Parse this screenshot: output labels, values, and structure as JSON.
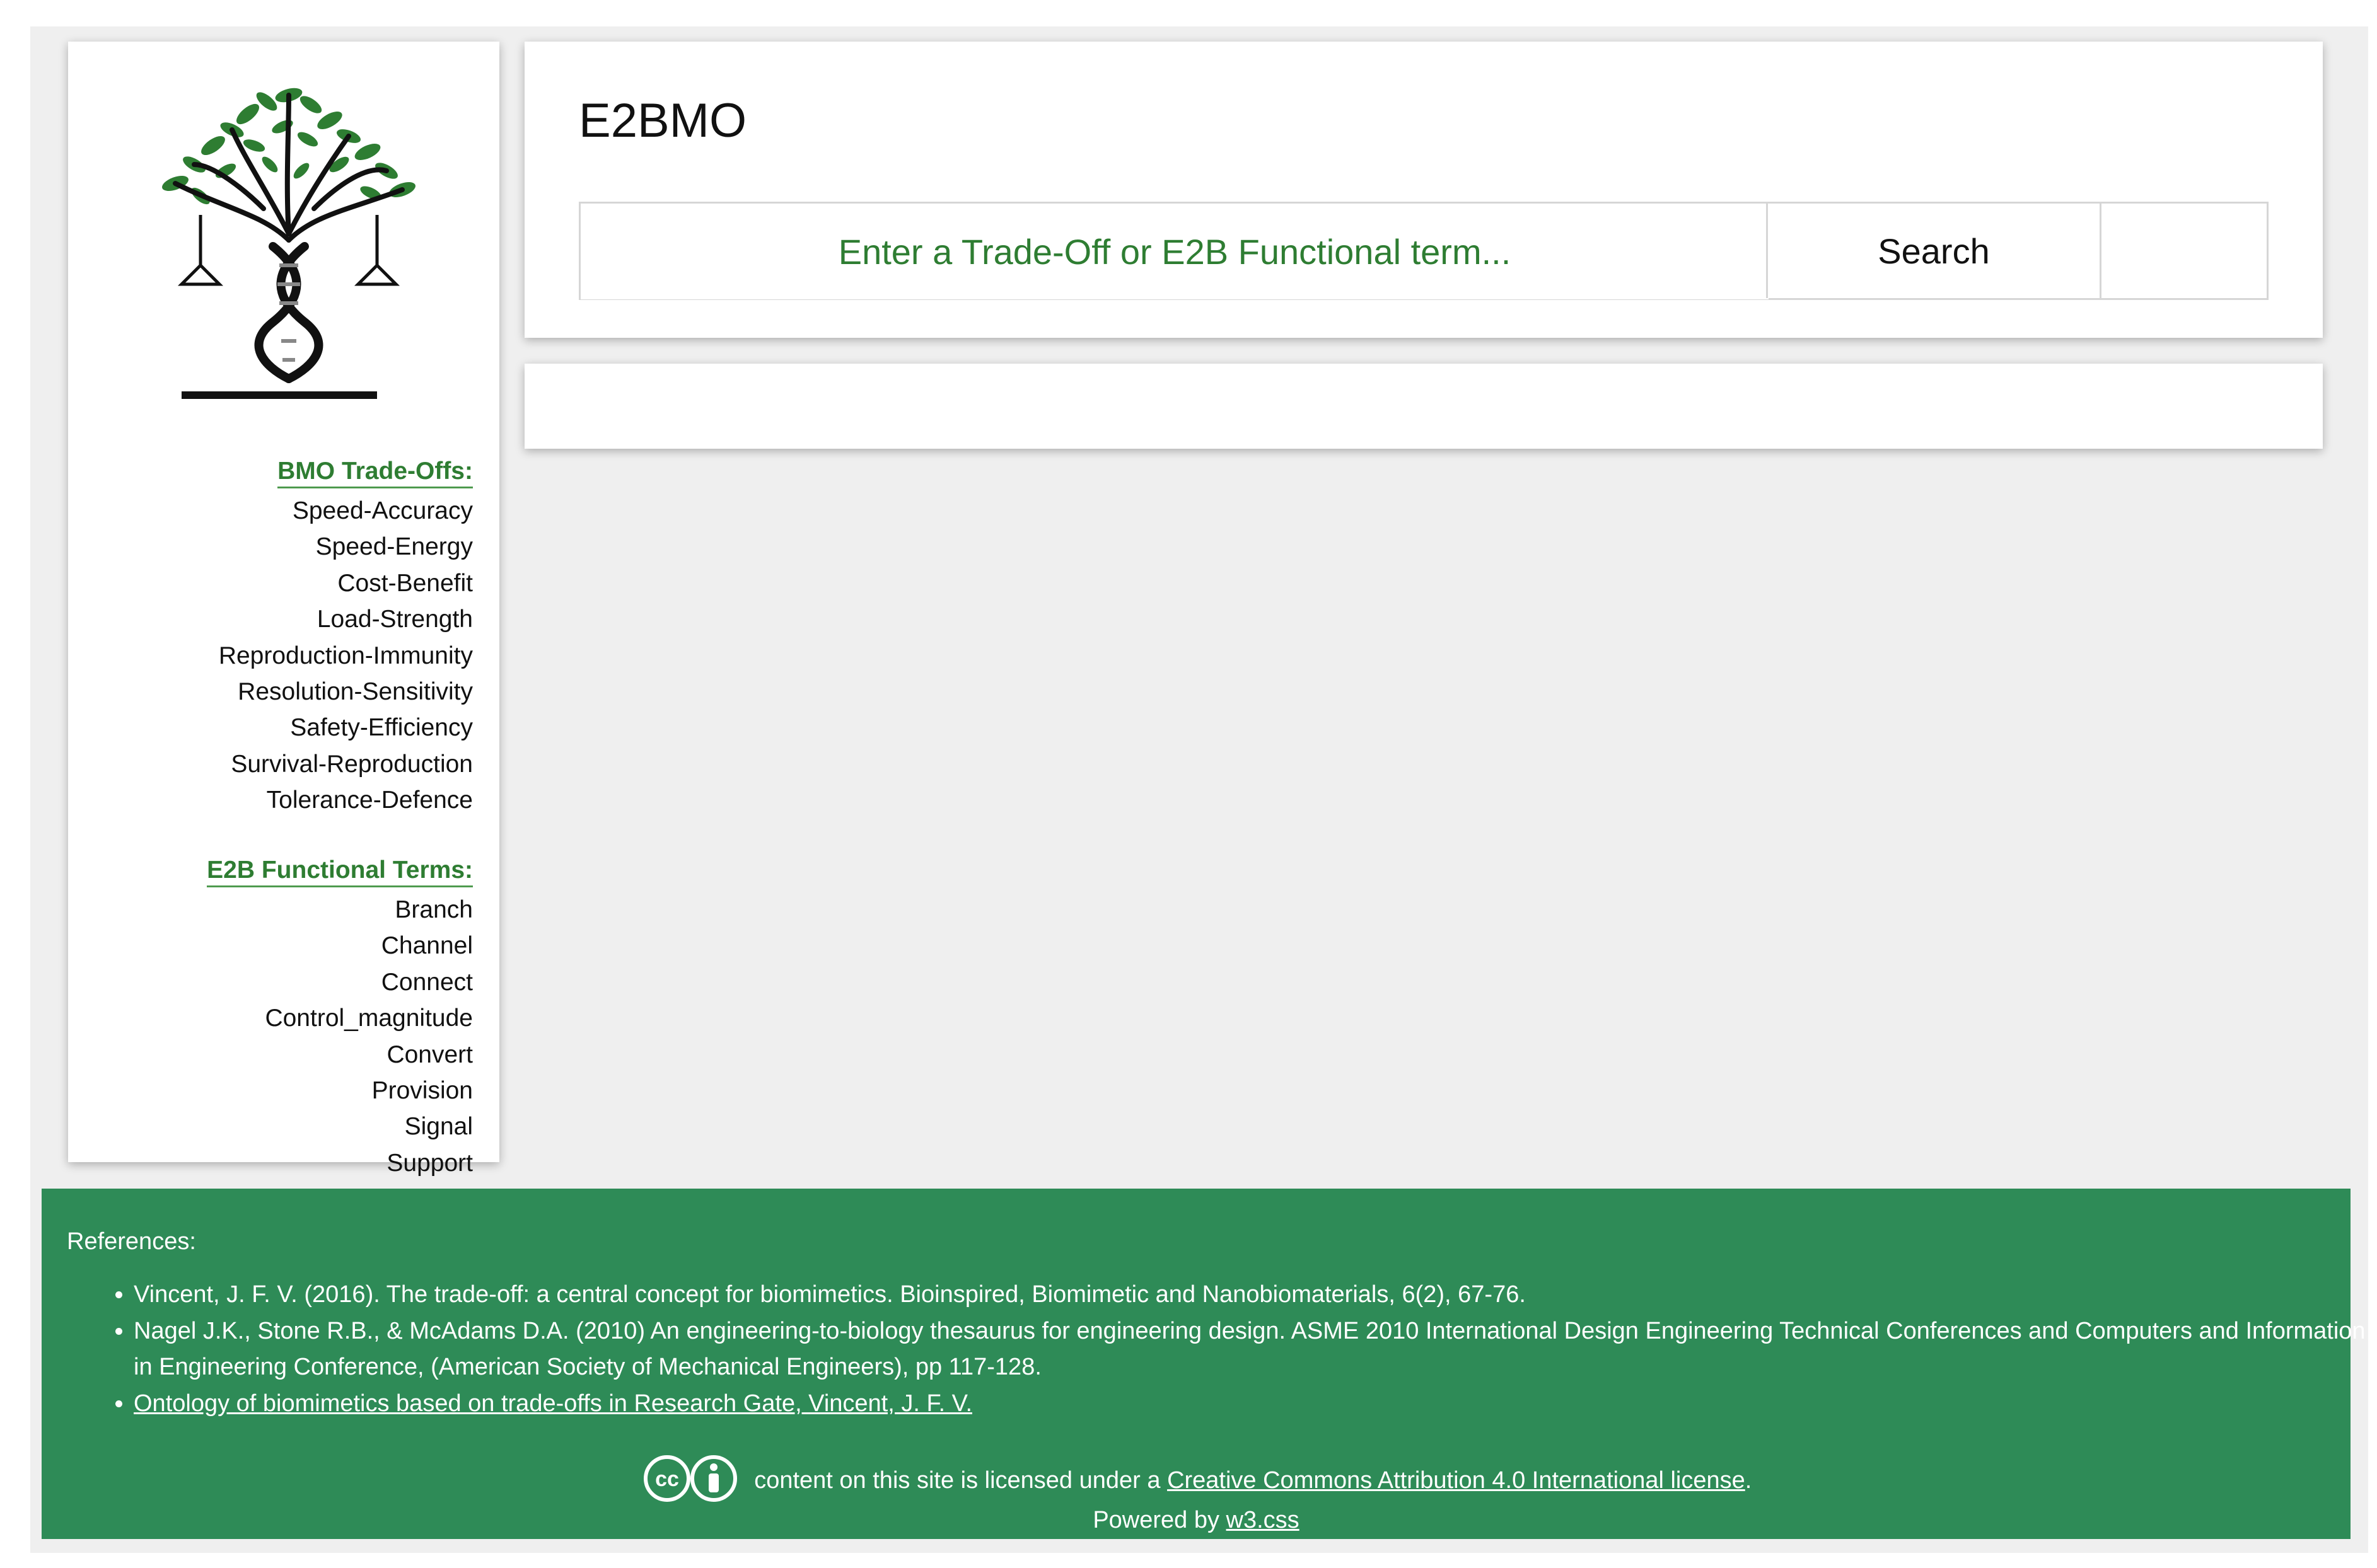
{
  "app": {
    "title": "E2BMO"
  },
  "search": {
    "placeholder": "Enter a Trade-Off or E2B Functional term...",
    "button_label": "Search"
  },
  "sidebar": {
    "tradeoffs_heading": "BMO Trade-Offs:",
    "tradeoffs": [
      "Speed-Accuracy",
      "Speed-Energy",
      "Cost-Benefit",
      "Load-Strength",
      "Reproduction-Immunity",
      "Resolution-Sensitivity",
      "Safety-Efficiency",
      "Survival-Reproduction",
      "Tolerance-Defence"
    ],
    "terms_heading": "E2B Functional Terms:",
    "terms": [
      "Branch",
      "Channel",
      "Connect",
      "Control_magnitude",
      "Convert",
      "Provision",
      "Signal",
      "Support"
    ]
  },
  "footer": {
    "references_label": "References:",
    "references": [
      "Vincent, J. F. V. (2016). The trade-off: a central concept for biomimetics. Bioinspired, Biomimetic and Nanobiomaterials, 6(2), 67-76.",
      "Nagel J.K., Stone R.B., & McAdams D.A. (2010) An engineering-to-biology thesaurus for engineering design. ASME 2010 International Design Engineering Technical Conferences and Computers and Information in Engineering Conference, (American Society of Mechanical Engineers), pp 117-128.",
      "Ontology of biomimetics based on trade-offs in Research Gate, Vincent, J. F. V."
    ],
    "license_prefix": "content on this site is licensed under a",
    "license_link": "Creative Commons Attribution 4.0 International license",
    "license_suffix": ".",
    "powered_prefix": "Powered by",
    "powered_link": "w3.css"
  },
  "colors": {
    "accent_green": "#2e7d32",
    "footer_green": "#2e8b57",
    "background": "#efefef"
  },
  "icons": {
    "logo": "tree-dna-scales-logo",
    "license": "creative-commons-by-icon"
  }
}
